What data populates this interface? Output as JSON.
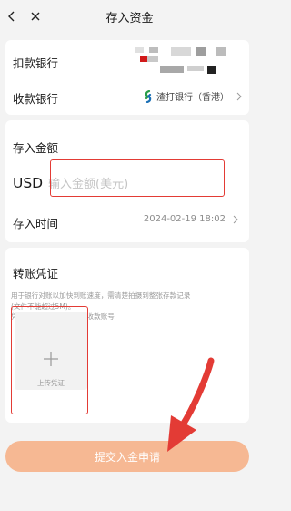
{
  "nav": {
    "title": "存入资金"
  },
  "banks": {
    "debit_label": "扣款银行",
    "payee_label": "收款银行",
    "payee_bank": "渣打银行（香港）"
  },
  "amount": {
    "title": "存入金额",
    "currency": "USD",
    "placeholder": "输入金额(美元)",
    "value": "",
    "time_label": "存入时间",
    "time_value": "2024-02-19 18:02"
  },
  "proof": {
    "title": "转账凭证",
    "desc_line1": "用于银行对账以加快到账速度，需清楚拍摄到整张存款记录",
    "desc_line2": "(文件不能超过5M)。",
    "desc_line3": "凭证需包含：扣款账号、收款账号",
    "upload_label": "上传凭证"
  },
  "submit": {
    "label": "提交入金申请"
  },
  "colors": {
    "highlight": "#e33b35",
    "submit_bg": "#f6b893",
    "sc_green": "#2a9d47",
    "sc_blue": "#1a6fb5",
    "page_bg": "#f3f3f3"
  }
}
